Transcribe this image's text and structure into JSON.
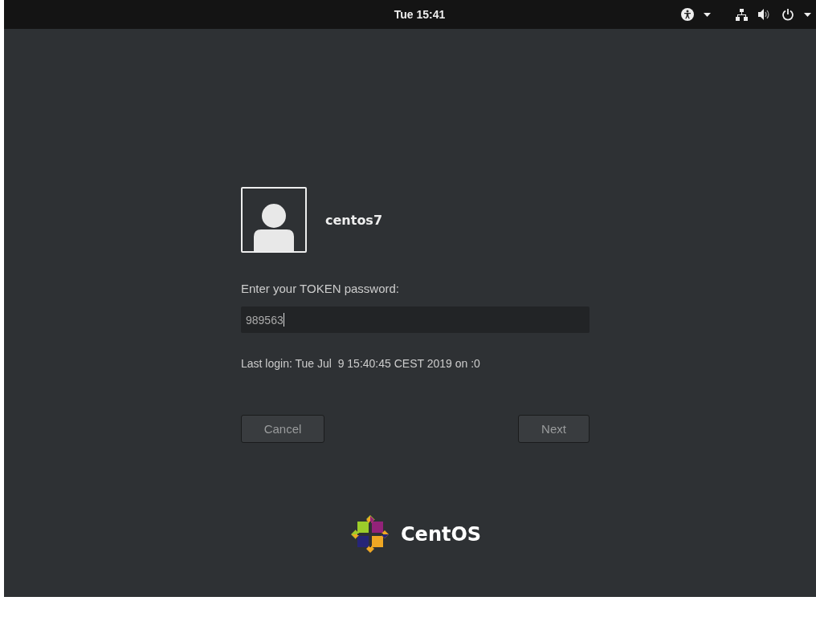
{
  "top_bar": {
    "clock": "Tue 15:41"
  },
  "user": {
    "name": "centos7"
  },
  "prompt": {
    "label": "Enter your TOKEN password:",
    "value": "989563"
  },
  "last_login": "Last login: Tue Jul  9 15:40:45 CEST 2019 on :0",
  "buttons": [
    {
      "label": "Cancel",
      "kind": "cancel"
    },
    {
      "label": "Next",
      "kind": "next"
    }
  ],
  "logo": {
    "text": "CentOS"
  }
}
